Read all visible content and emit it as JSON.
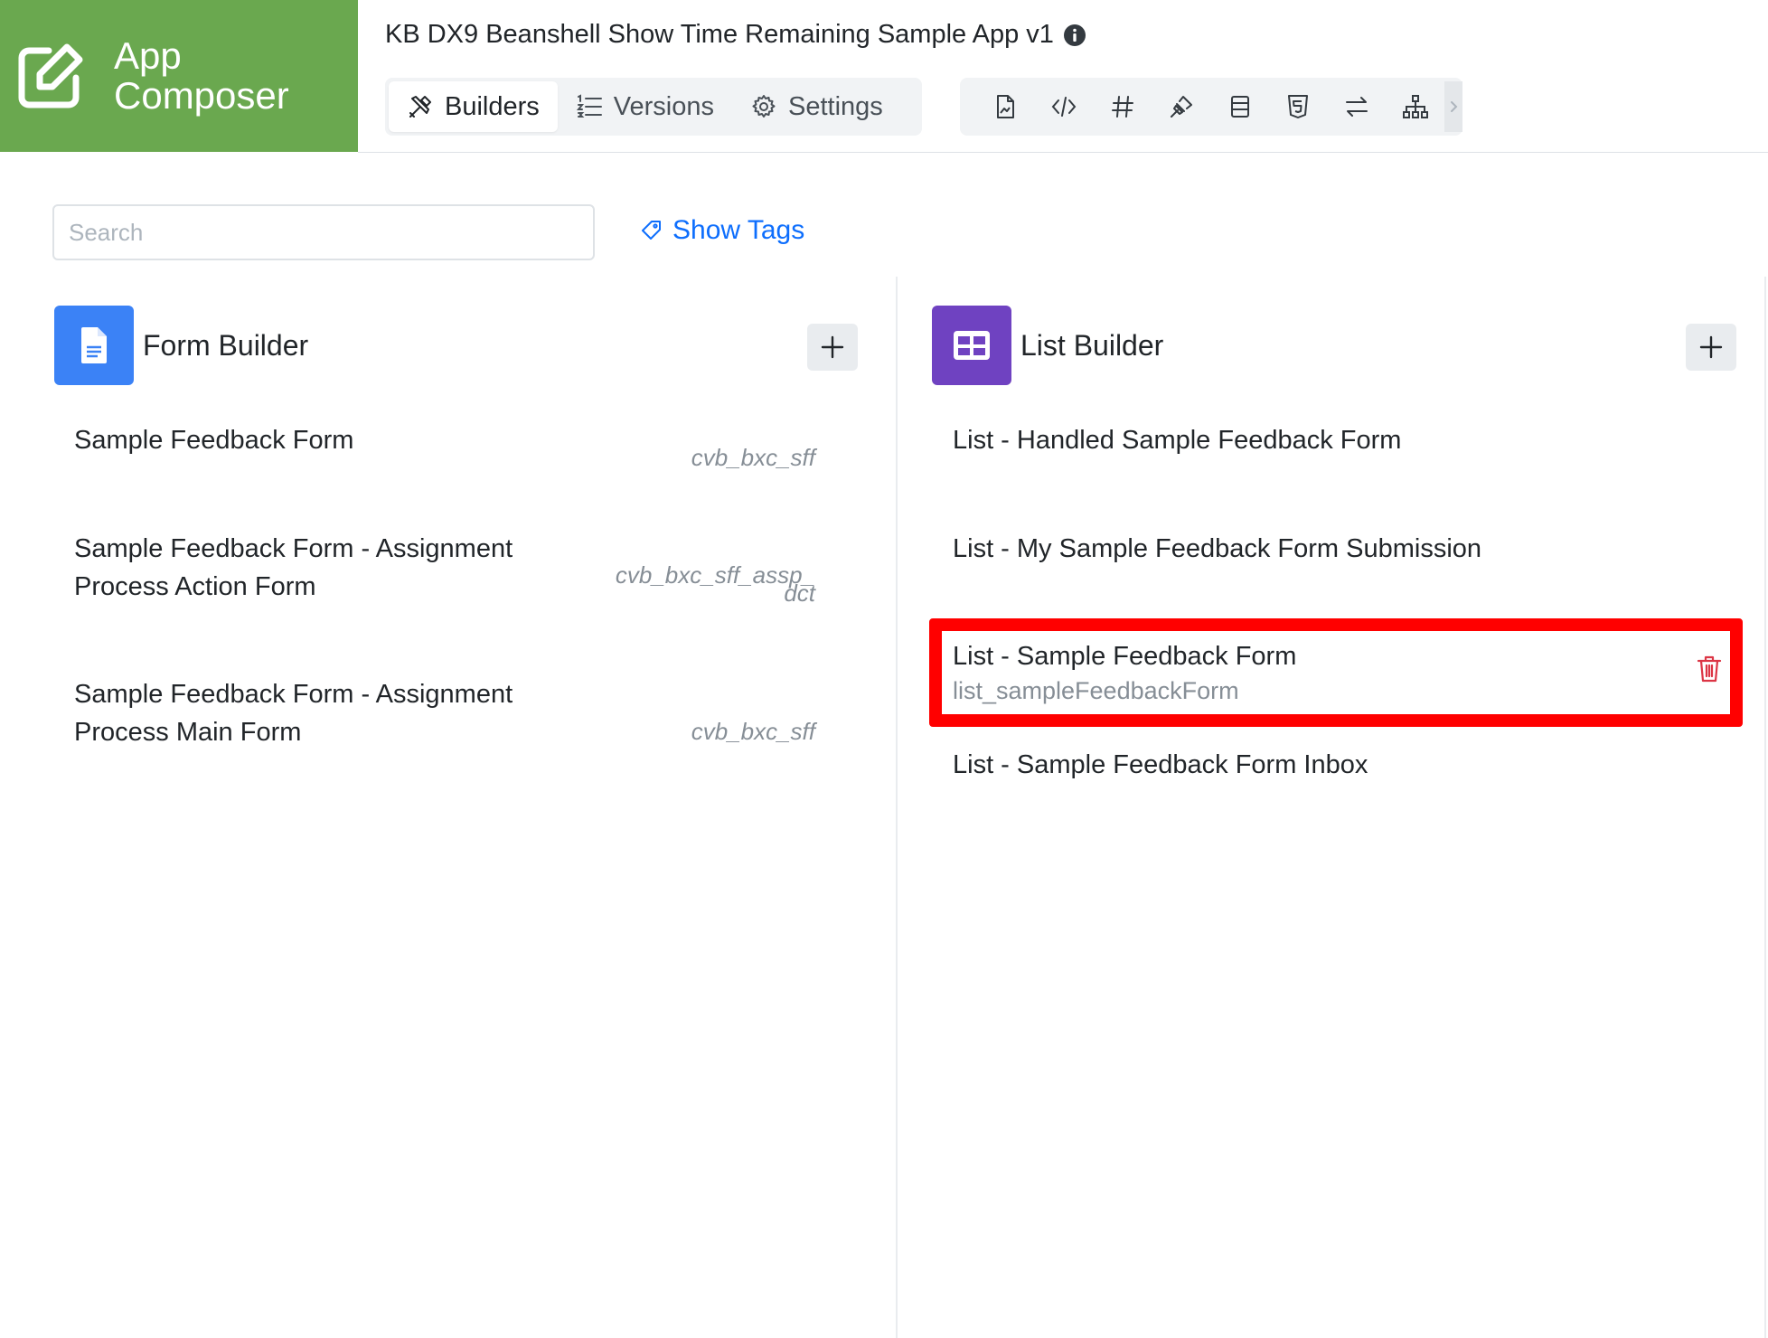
{
  "logo": {
    "line1": "App",
    "line2": "Composer"
  },
  "app_title": "KB DX9 Beanshell Show Time Remaining Sample App v1",
  "tabs": [
    {
      "label": "Builders",
      "icon": "tools-icon",
      "active": true
    },
    {
      "label": "Versions",
      "icon": "list-ordered-icon",
      "active": false
    },
    {
      "label": "Settings",
      "icon": "gear-icon",
      "active": false
    }
  ],
  "toolbar_icons": [
    "page-icon",
    "code-icon",
    "hash-icon",
    "plugin-icon",
    "table-layout-icon",
    "html5-icon",
    "swap-icon",
    "sitemap-icon",
    "chevron-right-icon"
  ],
  "search": {
    "placeholder": "Search",
    "value": ""
  },
  "show_tags": "Show Tags",
  "form_builder": {
    "title": "Form Builder",
    "color": "#3b82f6",
    "items": [
      {
        "label": "Sample Feedback Form",
        "id": "cvb_bxc_sff"
      },
      {
        "label_line1": "Sample Feedback Form - Assignment",
        "label_line2": "Process Action Form",
        "id_line1": "cvb_bxc_sff_assp_",
        "id_line2": "dct"
      },
      {
        "label_line1": "Sample Feedback Form - Assignment",
        "label_line2": "Process Main Form",
        "id": "cvb_bxc_sff"
      }
    ]
  },
  "list_builder": {
    "title": "List Builder",
    "color": "#6f42c1",
    "items": [
      {
        "label": "List - Handled Sample Feedback Form"
      },
      {
        "label": "List - My Sample Feedback Form Submission"
      },
      {
        "label": "List - Sample Feedback Form",
        "id": "list_sampleFeedbackForm",
        "selected": true
      },
      {
        "label": "List - Sample Feedback Form Inbox"
      }
    ]
  },
  "colors": {
    "brand_green": "#6aa84f",
    "link_blue": "#0d6efd",
    "highlight_red": "#ff0000",
    "delete_red": "#dc3545"
  }
}
